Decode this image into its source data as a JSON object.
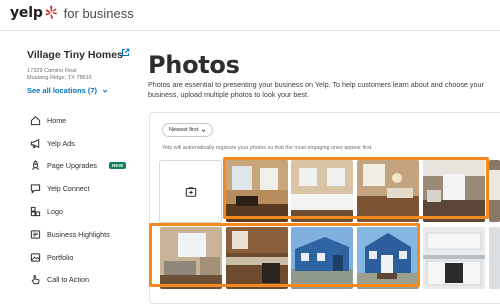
{
  "header": {
    "logo_text": "yelp",
    "logo_suffix": "for business",
    "brand_color": "#d32323"
  },
  "sidebar": {
    "business_name": "Village Tiny Homes",
    "address_line1": "17329 Camino Real",
    "address_line2": "Mustang Ridge, TX 78616",
    "see_all_locations": "See all locations (7)",
    "nav_items": [
      {
        "label": "Home",
        "icon": "home-icon"
      },
      {
        "label": "Yelp Ads",
        "icon": "megaphone-icon"
      },
      {
        "label": "Page Upgrades",
        "icon": "rocket-icon",
        "badge": "NEW"
      },
      {
        "label": "Yelp Connect",
        "icon": "speech-bubble-icon"
      },
      {
        "label": "Logo",
        "icon": "logo-blocks-icon"
      },
      {
        "label": "Business Highlights",
        "icon": "highlights-icon"
      },
      {
        "label": "Portfolio",
        "icon": "portfolio-icon"
      },
      {
        "label": "Call to Action",
        "icon": "hand-pointer-icon"
      }
    ]
  },
  "main": {
    "title": "Photos",
    "intro": "Photos are essential to presenting your business on Yelp. To help customers learn about and choose your business, upload multiple photos to look your best.",
    "sort_label": "Newest first",
    "sort_note": "Yelp will automatically organize your photos so that the most engaging ones appear first.",
    "highlight_color": "#f4891f",
    "photos": [
      {
        "name": "interior-living-room-window"
      },
      {
        "name": "interior-bedroom"
      },
      {
        "name": "interior-kitchen-window"
      },
      {
        "name": "interior-bathroom"
      },
      {
        "name": "interior-kitchen-sink"
      },
      {
        "name": "interior-living-room"
      },
      {
        "name": "interior-kitchen-cabinets"
      },
      {
        "name": "exterior-blue-tiny-home-side"
      },
      {
        "name": "exterior-blue-tiny-home-front"
      },
      {
        "name": "interior-white-kitchen"
      }
    ]
  }
}
